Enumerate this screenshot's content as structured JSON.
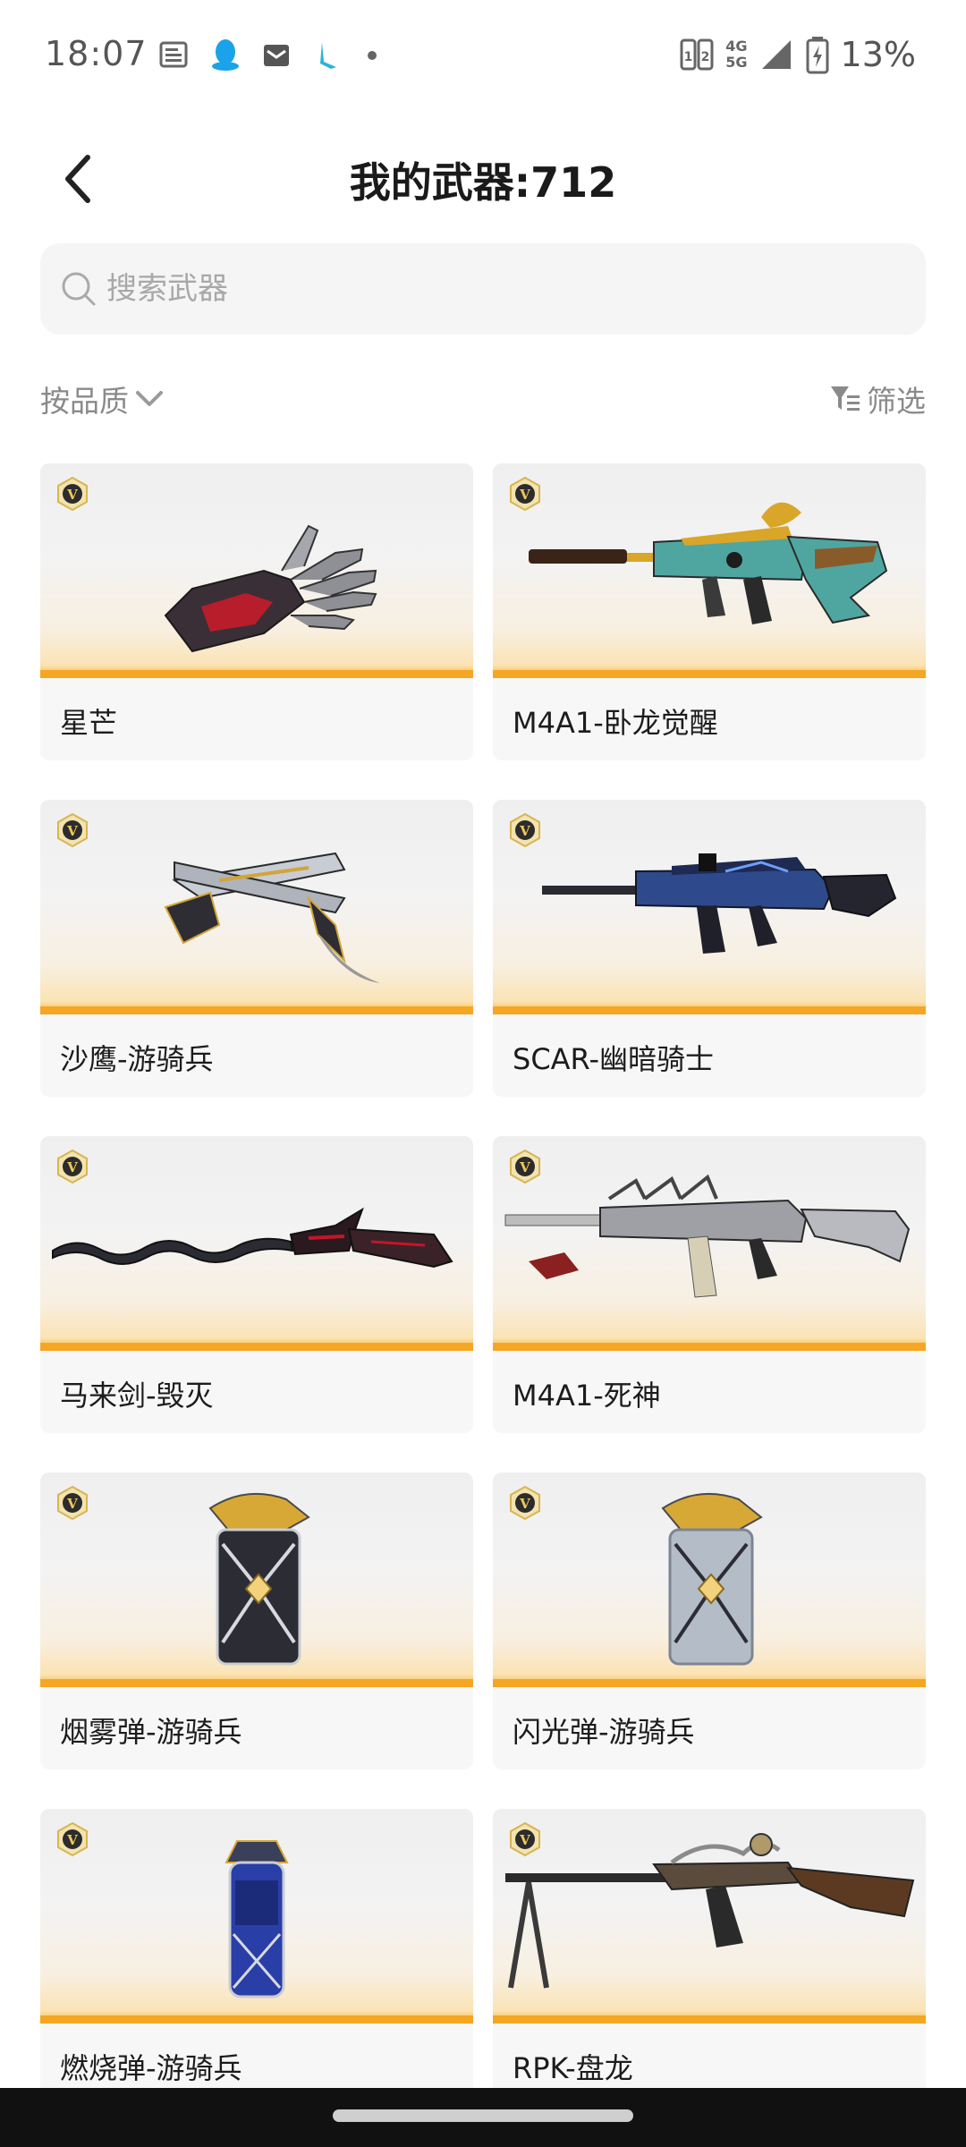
{
  "status_bar": {
    "time": "18:07",
    "network": "4G",
    "network2": "5G",
    "battery": "13%",
    "left_icons": [
      "news-icon",
      "qq-icon",
      "mail-icon",
      "tool-icon",
      "dot-icon"
    ]
  },
  "header": {
    "title": "我的武器:712"
  },
  "search": {
    "placeholder": "搜索武器"
  },
  "controls": {
    "sort_label": "按品质",
    "filter_label": "筛选"
  },
  "weapons": [
    {
      "name": "星芒",
      "icon": "gauntlet-icon"
    },
    {
      "name": "M4A1-卧龙觉醒",
      "icon": "rifle-icon"
    },
    {
      "name": "沙鹰-游骑兵",
      "icon": "pistol-icon"
    },
    {
      "name": "SCAR-幽暗骑士",
      "icon": "rifle-icon"
    },
    {
      "name": "马来剑-毁灭",
      "icon": "sword-icon"
    },
    {
      "name": "M4A1-死神",
      "icon": "rifle-icon"
    },
    {
      "name": "烟雾弹-游骑兵",
      "icon": "grenade-icon"
    },
    {
      "name": "闪光弹-游骑兵",
      "icon": "grenade-icon"
    },
    {
      "name": "燃烧弹-游骑兵",
      "icon": "grenade-icon"
    },
    {
      "name": "RPK-盘龙",
      "icon": "machine-gun-icon"
    }
  ],
  "colors": {
    "accent_orange": "#f5a623",
    "card_bg": "#f7f7f7",
    "search_bg": "#f5f5f5",
    "muted_text": "#8a8a8a"
  }
}
